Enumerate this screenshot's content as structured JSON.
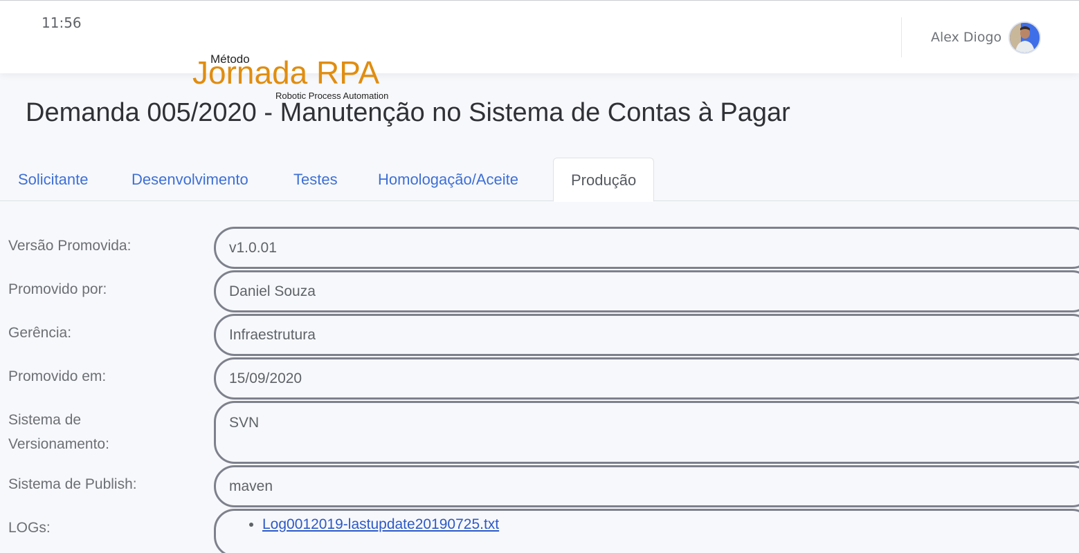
{
  "header": {
    "clock": "11:56",
    "user_name": "Alex Diogo"
  },
  "logo": {
    "metodo": "Método",
    "main": "Jornada RPA",
    "sub": "Robotic Process Automation"
  },
  "page": {
    "title": "Demanda 005/2020 - Manutenção no Sistema de Contas à Pagar"
  },
  "tabs": [
    {
      "label": "Solicitante",
      "active": false
    },
    {
      "label": "Desenvolvimento",
      "active": false
    },
    {
      "label": "Testes",
      "active": false
    },
    {
      "label": "Homologação/Aceite",
      "active": false
    },
    {
      "label": "Produção",
      "active": true
    }
  ],
  "form": {
    "versao": {
      "label": "Versão Promovida:",
      "value": "v1.0.01"
    },
    "promovido_por": {
      "label": "Promovido por:",
      "value": "Daniel Souza"
    },
    "gerencia": {
      "label": "Gerência:",
      "value": "Infraestrutura"
    },
    "promovido_em": {
      "label": "Promovido em:",
      "value": "15/09/2020"
    },
    "versionamento": {
      "label_line1": "Sistema de",
      "label_line2": "Versionamento:",
      "value": "SVN"
    },
    "publish": {
      "label": "Sistema de Publish:",
      "value": "maven"
    },
    "logs": {
      "label": "LOGs:",
      "files": [
        "Log0012019-lastupdate20190725.txt"
      ]
    }
  },
  "colors": {
    "accent_link": "#3d6fd6",
    "logo_orange": "#e08d10",
    "field_border": "#7e808c",
    "page_bg": "#f7f8fb"
  }
}
